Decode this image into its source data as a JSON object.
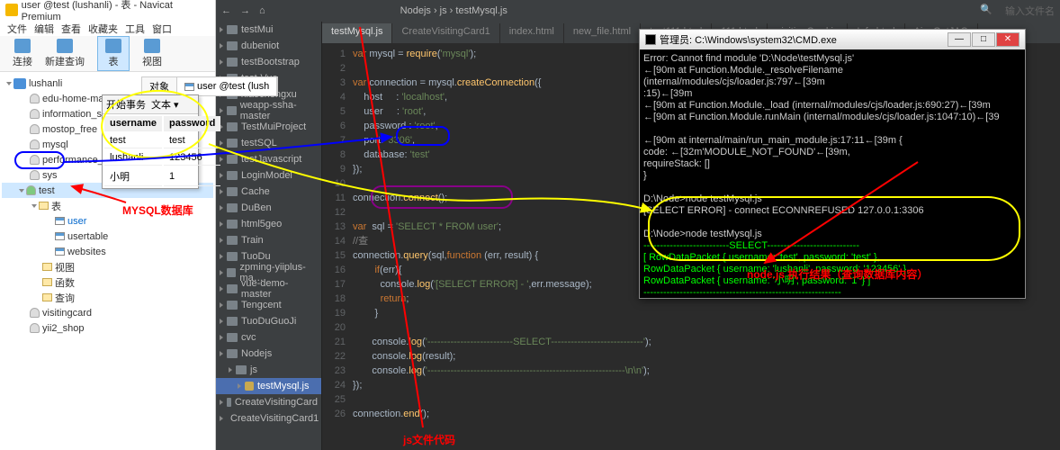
{
  "navicat": {
    "title": "user @test (lushanli) - 表 - Navicat Premium",
    "menu": [
      "文件",
      "编辑",
      "查看",
      "收藏夹",
      "工具",
      "窗口"
    ],
    "toolbar": [
      {
        "label": "连接"
      },
      {
        "label": "新建查询"
      },
      {
        "label": "表",
        "sel": true
      },
      {
        "label": "视图"
      }
    ],
    "tree": [
      {
        "lvl": 0,
        "t": "lushanli",
        "ico": "conn",
        "exp": true
      },
      {
        "lvl": 1,
        "t": "edu-home-manage",
        "ico": "db"
      },
      {
        "lvl": 1,
        "t": "information_schema",
        "ico": "db"
      },
      {
        "lvl": 1,
        "t": "mostop_free",
        "ico": "db"
      },
      {
        "lvl": 1,
        "t": "mysql",
        "ico": "db"
      },
      {
        "lvl": 1,
        "t": "performance_schem…",
        "ico": "db"
      },
      {
        "lvl": 1,
        "t": "sys",
        "ico": "db"
      },
      {
        "lvl": 1,
        "t": "test",
        "ico": "dbg",
        "sel": true,
        "exp": true
      },
      {
        "lvl": 2,
        "t": "表",
        "ico": "f",
        "exp": true
      },
      {
        "lvl": 3,
        "t": "user",
        "ico": "tbl",
        "hl": true
      },
      {
        "lvl": 3,
        "t": "usertable",
        "ico": "tbl"
      },
      {
        "lvl": 3,
        "t": "websites",
        "ico": "tbl"
      },
      {
        "lvl": 2,
        "t": "视图",
        "ico": "f"
      },
      {
        "lvl": 2,
        "t": "函数",
        "ico": "f"
      },
      {
        "lvl": 2,
        "t": "查询",
        "ico": "f"
      },
      {
        "lvl": 1,
        "t": "visitingcard",
        "ico": "db"
      },
      {
        "lvl": 1,
        "t": "yii2_shop",
        "ico": "db"
      }
    ]
  },
  "tabbar": {
    "tabs": [
      "对象",
      "user @test (lush"
    ]
  },
  "dbpop": {
    "menu": "开始事务",
    "btn": "文本 ▾",
    "head": [
      "username",
      "password"
    ],
    "rows": [
      [
        "test",
        "test"
      ],
      [
        "lushanli",
        "123456"
      ],
      [
        "小明",
        "1"
      ]
    ]
  },
  "editor": {
    "breadcrumb": [
      "Nodejs",
      "js",
      "testMysql.js"
    ],
    "search_placeholder": "输入文件名",
    "tree": [
      {
        "t": "testMui",
        "ico": "f"
      },
      {
        "t": "dubeniot",
        "ico": "f"
      },
      {
        "t": "testBootstrap",
        "ico": "f"
      },
      {
        "t": "test-Vue",
        "ico": "f"
      },
      {
        "t": "xiaochengxu",
        "ico": "f"
      },
      {
        "t": "weapp-ssha-master",
        "ico": "f"
      },
      {
        "t": "TestMuiProject",
        "ico": "f"
      },
      {
        "t": "testSQL",
        "ico": "f"
      },
      {
        "t": "testJavascript",
        "ico": "f"
      },
      {
        "t": "LoginModel",
        "ico": "f"
      },
      {
        "t": "Cache",
        "ico": "f"
      },
      {
        "t": "DuBen",
        "ico": "f"
      },
      {
        "t": "html5geo",
        "ico": "f"
      },
      {
        "t": "Train",
        "ico": "f"
      },
      {
        "t": "TuoDu",
        "ico": "f"
      },
      {
        "t": "zpming-yiiplus-ma…",
        "ico": "f"
      },
      {
        "t": "vue-demo-master",
        "ico": "f"
      },
      {
        "t": "Tengcent",
        "ico": "f"
      },
      {
        "t": "TuoDuGuoJi",
        "ico": "f"
      },
      {
        "t": "cvc",
        "ico": "f"
      },
      {
        "t": "Nodejs",
        "ico": "f",
        "exp": true
      },
      {
        "t": "js",
        "ico": "f",
        "exp": true,
        "lvl": 1
      },
      {
        "t": "testMysql.js",
        "ico": "j",
        "sel": true,
        "lvl": 2
      },
      {
        "t": "CreateVisitingCard",
        "ico": "f"
      },
      {
        "t": "CreateVisitingCard1",
        "ico": "f"
      }
    ],
    "tabs": [
      "testMysql.js",
      "CreateVisitingCard1",
      "index.html",
      "new_file.html",
      "test111.html",
      "111.html",
      "visitingCard.js",
      "Info.html",
      "AjaxGetJAC"
    ],
    "active_tab": 0,
    "code": [
      {
        "n": 1,
        "h": "<span class='kw'>var</span> mysql = <span class='fn'>require</span>(<span class='str'>'mysql'</span>);"
      },
      {
        "n": 2,
        "h": ""
      },
      {
        "n": 3,
        "h": "<span class='kw'>var</span> connection = mysql.<span class='fn'>createConnection</span>({"
      },
      {
        "n": 4,
        "h": "    host     : <span class='str'>'localhost'</span>,"
      },
      {
        "n": 5,
        "h": "    user     : <span class='str'>'root'</span>,"
      },
      {
        "n": 6,
        "h": "    password : <span class='str'>'root'</span>,"
      },
      {
        "n": 7,
        "h": "    port: <span class='str'>'3306'</span>,"
      },
      {
        "n": 8,
        "h": "    database: <span class='str'>'test'</span>"
      },
      {
        "n": 9,
        "h": "});"
      },
      {
        "n": 10,
        "h": ""
      },
      {
        "n": 11,
        "h": "connection.<span class='fn'>connect</span>();"
      },
      {
        "n": 12,
        "h": ""
      },
      {
        "n": 13,
        "h": "<span class='kw'>var</span>  sql = <span class='str'>'SELECT * FROM user'</span>;"
      },
      {
        "n": 14,
        "h": "<span class='cmt'>//查</span>"
      },
      {
        "n": 15,
        "h": "connection.<span class='fn'>query</span>(sql,<span class='kw'>function</span> (err, result) {"
      },
      {
        "n": 16,
        "h": "        <span class='kw'>if</span>(err){"
      },
      {
        "n": 17,
        "h": "          console.<span class='fn'>log</span>(<span class='str'>'[SELECT ERROR] - '</span>,err.message);"
      },
      {
        "n": 18,
        "h": "          <span class='kw'>return</span>;"
      },
      {
        "n": 19,
        "h": "        }"
      },
      {
        "n": 20,
        "h": ""
      },
      {
        "n": 21,
        "h": "       console.<span class='fn'>log</span>(<span class='str'>'--------------------------SELECT----------------------------'</span>);"
      },
      {
        "n": 22,
        "h": "       console.<span class='fn'>log</span>(result);"
      },
      {
        "n": 23,
        "h": "       console.<span class='fn'>log</span>(<span class='str'>'------------------------------------------------------------\\n\\n'</span>);"
      },
      {
        "n": 24,
        "h": "});"
      },
      {
        "n": 25,
        "h": ""
      },
      {
        "n": 26,
        "h": "connection.<span class='fn'>end</span>();"
      }
    ]
  },
  "terminal": {
    "title": "管理员: C:\\Windows\\system32\\CMD.exe",
    "lines": [
      {
        "c": "err",
        "t": "Error: Cannot find module 'D:\\Node\\testMysql.js'"
      },
      {
        "c": "err",
        "t": "←[90m    at Function.Module._resolveFilename (internal/modules/cjs/loader.js:797←[39m"
      },
      {
        "c": "err",
        "t": ":15)←[39m"
      },
      {
        "c": "err",
        "t": "←[90m    at Function.Module._load (internal/modules/cjs/loader.js:690:27)←[39m"
      },
      {
        "c": "err",
        "t": "←[90m    at Function.Module.runMain (internal/modules/cjs/loader.js:1047:10)←[39"
      },
      {
        "c": "err",
        "t": ""
      },
      {
        "c": "err",
        "t": "←[90m    at internal/main/run_main_module.js:17:11←[39m {"
      },
      {
        "c": "err",
        "t": "  code: ←[32m'MODULE_NOT_FOUND'←[39m,"
      },
      {
        "c": "err",
        "t": "  requireStack: []"
      },
      {
        "c": "err",
        "t": "}"
      },
      {
        "c": "",
        "t": ""
      },
      {
        "c": "",
        "t": "D:\\Node>node testMysql.js"
      },
      {
        "c": "",
        "t": "[SELECT ERROR] -  connect ECONNREFUSED 127.0.0.1:3306"
      },
      {
        "c": "",
        "t": ""
      },
      {
        "c": "",
        "t": "D:\\Node>node testMysql.js"
      },
      {
        "c": "grn",
        "t": "--------------------------SELECT----------------------------"
      },
      {
        "c": "grn",
        "t": "[ RowDataPacket { username: 'test', password: 'test' },"
      },
      {
        "c": "grn",
        "t": "  RowDataPacket { username: 'lushanli', password: '123456' },"
      },
      {
        "c": "grn",
        "t": "  RowDataPacket { username: '小明', password: '1' } ]"
      },
      {
        "c": "grn",
        "t": "------------------------------------------------------------"
      },
      {
        "c": "",
        "t": ""
      },
      {
        "c": "",
        "t": ""
      },
      {
        "c": "",
        "t": "D:\\Node>"
      }
    ]
  },
  "annotations": {
    "a1": "MYSQL数据库",
    "a2": "js文件代码",
    "a3": "node.js 执行结果（查询数据库内容）"
  }
}
